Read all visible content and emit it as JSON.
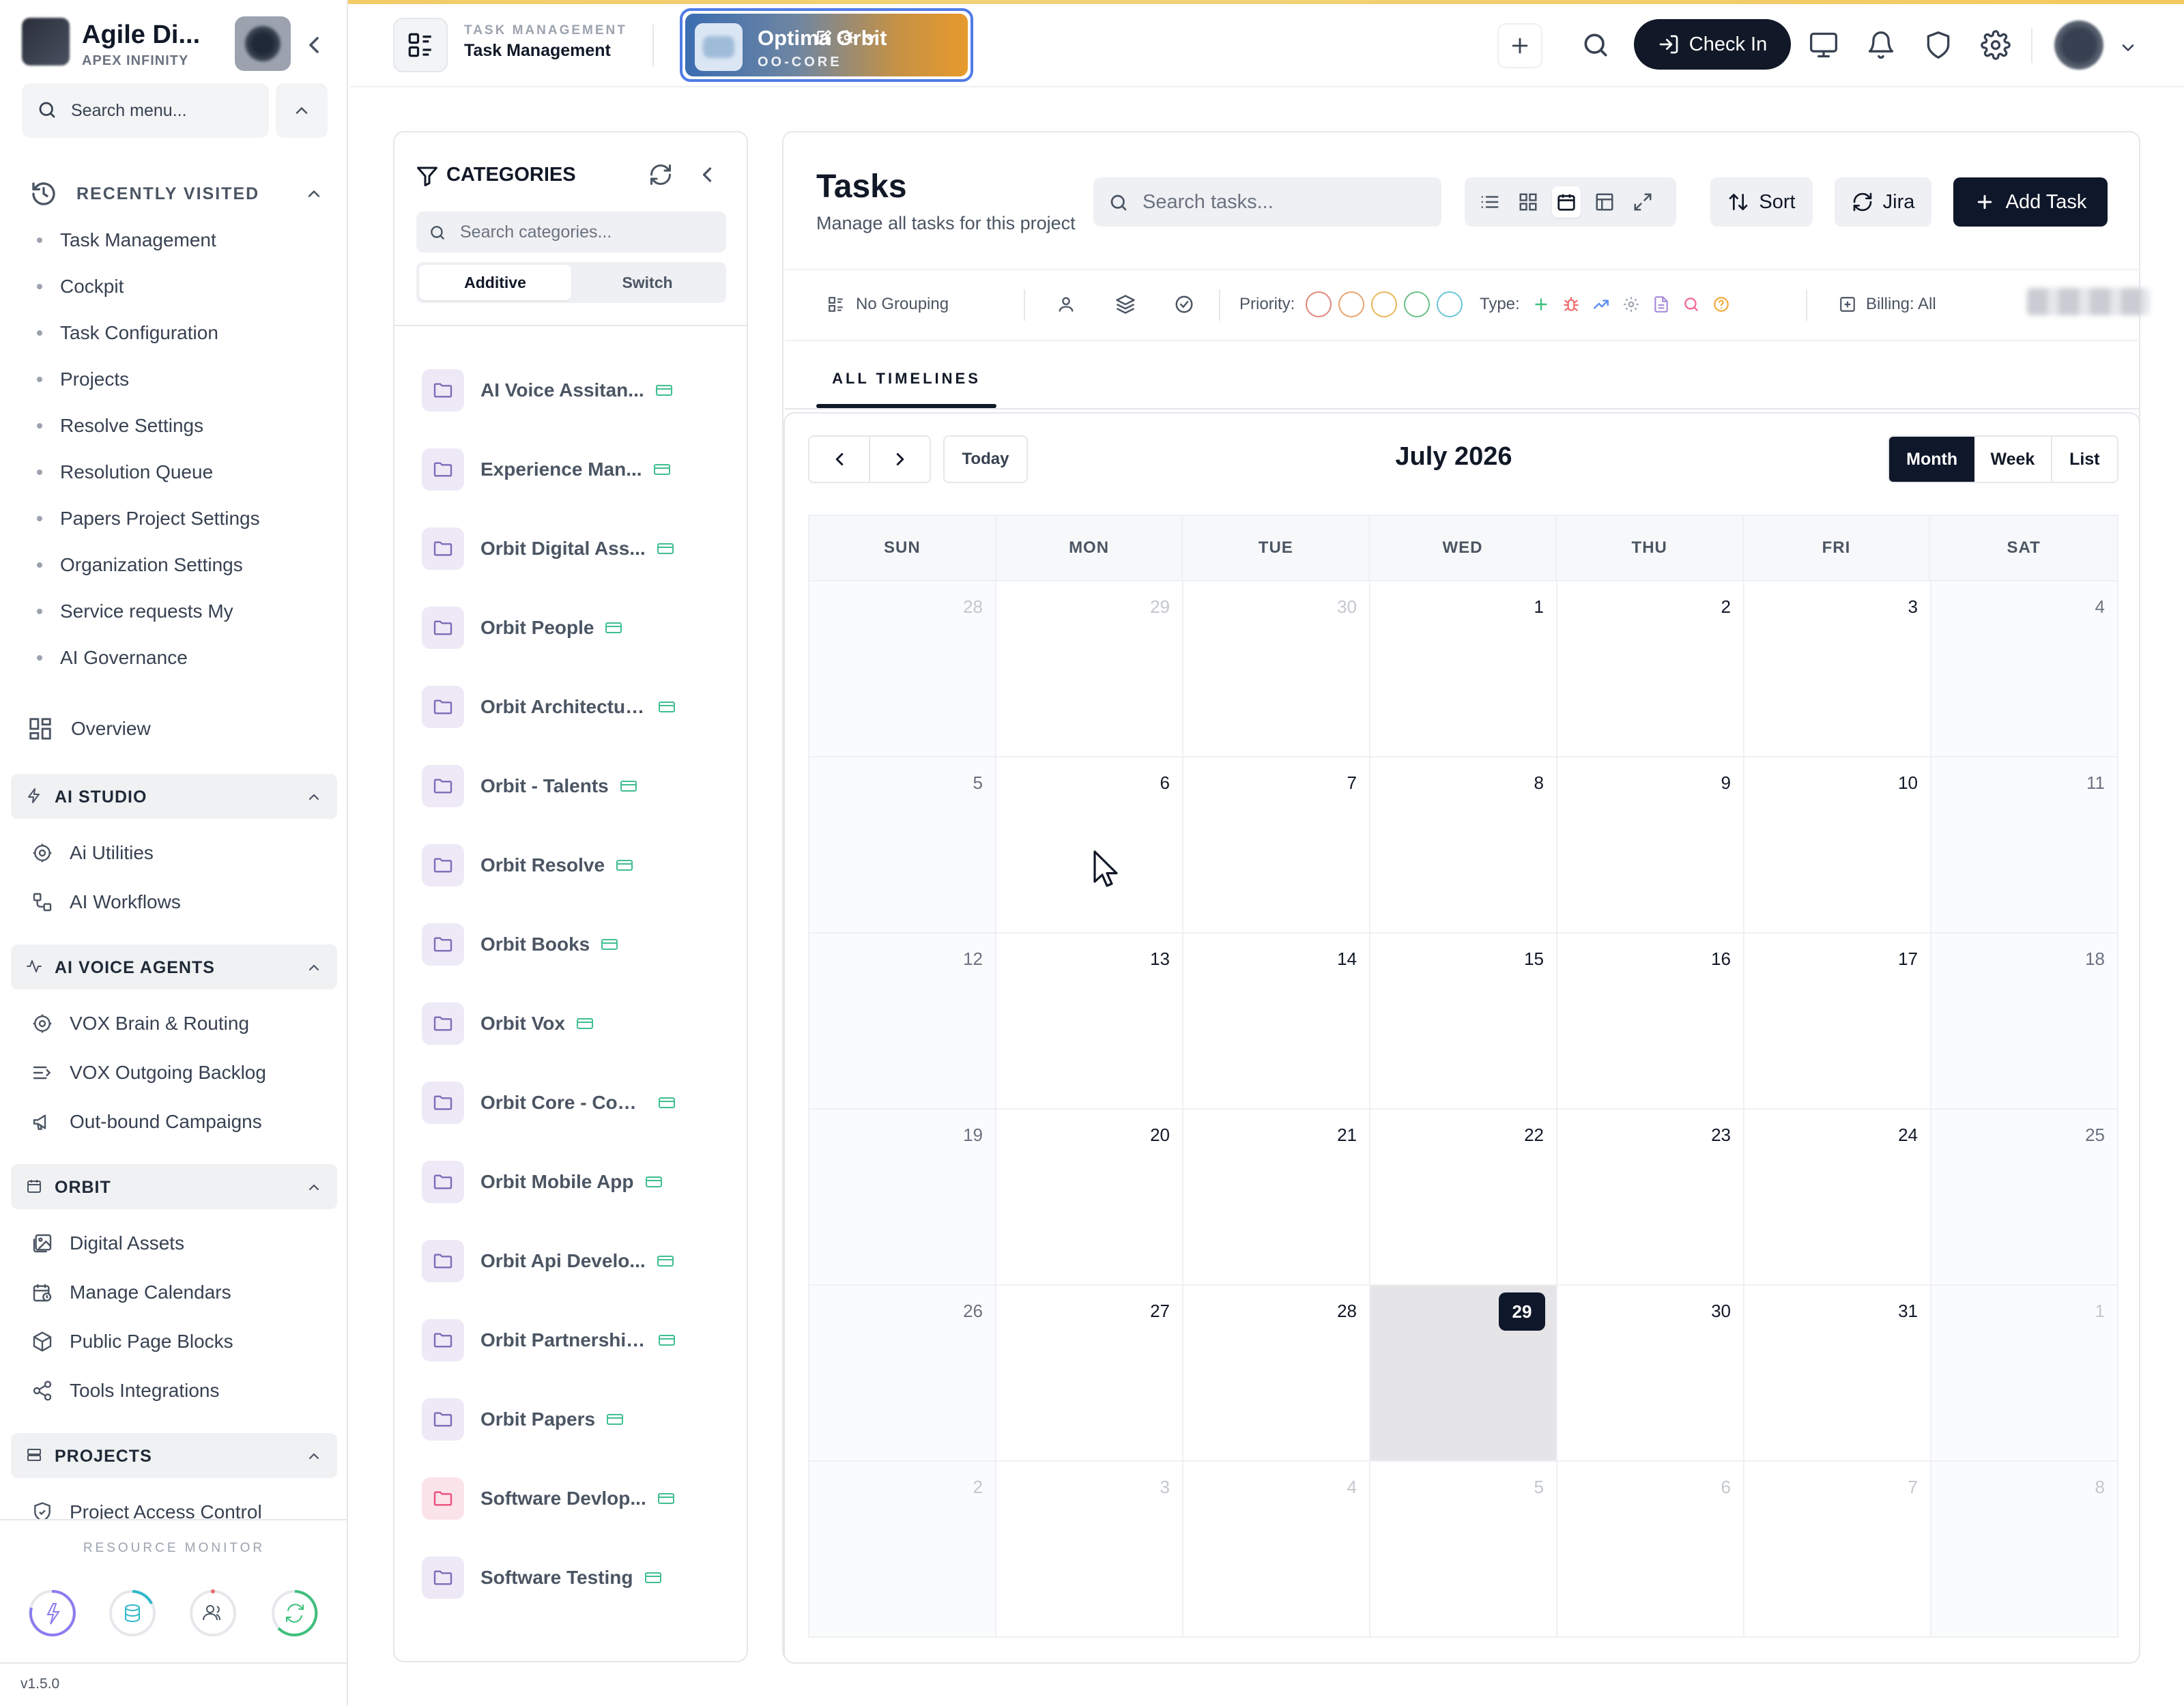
{
  "sidebar": {
    "brand": {
      "name": "Agile Di...",
      "sub": "APEX INFINITY"
    },
    "search_placeholder": "Search menu...",
    "recently_visited": {
      "title": "RECENTLY VISITED",
      "items": [
        {
          "label": "Task Management"
        },
        {
          "label": "Cockpit"
        },
        {
          "label": "Task Configuration"
        },
        {
          "label": "Projects"
        },
        {
          "label": "Resolve Settings"
        },
        {
          "label": "Resolution Queue"
        },
        {
          "label": "Papers Project Settings"
        },
        {
          "label": "Organization Settings"
        },
        {
          "label": "Service requests My"
        },
        {
          "label": "AI Governance"
        }
      ]
    },
    "overview_label": "Overview",
    "sections": [
      {
        "title": "AI STUDIO",
        "items": [
          {
            "label": "Ai Utilities",
            "icon": "gear-icon"
          },
          {
            "label": "AI Workflows",
            "icon": "workflow-icon"
          }
        ]
      },
      {
        "title": "AI VOICE AGENTS",
        "items": [
          {
            "label": "VOX Brain & Routing",
            "icon": "gear-icon"
          },
          {
            "label": "VOX Outgoing Backlog",
            "icon": "list-arrow-icon"
          },
          {
            "label": "Out-bound Campaigns",
            "icon": "megaphone-icon"
          }
        ]
      },
      {
        "title": "ORBIT",
        "items": [
          {
            "label": "Digital Assets",
            "icon": "image-icon"
          },
          {
            "label": "Manage Calendars",
            "icon": "calendar-clock-icon"
          },
          {
            "label": "Public Page Blocks",
            "icon": "box-icon"
          },
          {
            "label": "Tools Integrations",
            "icon": "share-icon"
          }
        ]
      },
      {
        "title": "PROJECTS",
        "items": [
          {
            "label": "Project Access Control",
            "icon": "shield-check-icon"
          }
        ]
      }
    ],
    "resource_monitor": {
      "title": "RESOURCE MONITOR"
    },
    "version": "v1.5.0"
  },
  "topbar": {
    "module_sub": "TASK MANAGEMENT",
    "module_title": "Task Management",
    "project": {
      "name": "Optima Orbit",
      "code": "OO-CORE"
    },
    "checkin_label": "Check In"
  },
  "categories": {
    "title": "CATEGORIES",
    "search_placeholder": "Search categories...",
    "mode_additive": "Additive",
    "mode_switch": "Switch",
    "items": [
      {
        "label": "AI Voice Assitan...",
        "color": "purple"
      },
      {
        "label": "Experience Man...",
        "color": "purple"
      },
      {
        "label": "Orbit Digital Ass...",
        "color": "purple"
      },
      {
        "label": "Orbit People",
        "color": "purple"
      },
      {
        "label": "Orbit Architectur...",
        "color": "purple"
      },
      {
        "label": "Orbit - Talents",
        "color": "purple"
      },
      {
        "label": "Orbit Resolve",
        "color": "purple"
      },
      {
        "label": "Orbit Books",
        "color": "purple"
      },
      {
        "label": "Orbit Vox",
        "color": "purple"
      },
      {
        "label": "Orbit Core - Com...",
        "color": "purple"
      },
      {
        "label": "Orbit Mobile App",
        "color": "purple"
      },
      {
        "label": "Orbit Api Develo...",
        "color": "purple"
      },
      {
        "label": "Orbit Partnerships",
        "color": "purple"
      },
      {
        "label": "Orbit Papers",
        "color": "purple"
      },
      {
        "label": "Software Devlop...",
        "color": "pink"
      },
      {
        "label": "Software Testing",
        "color": "purple"
      }
    ]
  },
  "tasks": {
    "title": "Tasks",
    "subtitle": "Manage all tasks for this project",
    "search_placeholder": "Search tasks...",
    "sort_label": "Sort",
    "jira_label": "Jira",
    "add_label": "Add Task",
    "filters": {
      "grouping": "No Grouping",
      "priority_label": "Priority:",
      "priority_colors": [
        "#e0867a",
        "#e8a470",
        "#e8b65a",
        "#6cc08a",
        "#6cc6d6"
      ],
      "type_label": "Type:",
      "billing": "Billing: All"
    },
    "timeline_tab": "ALL TIMELINES"
  },
  "calendar": {
    "title": "July 2026",
    "today_label": "Today",
    "views": {
      "month": "Month",
      "week": "Week",
      "list": "List"
    },
    "active_view": "Month",
    "weekdays": [
      "SUN",
      "MON",
      "TUE",
      "WED",
      "THU",
      "FRI",
      "SAT"
    ],
    "today": 29,
    "days": [
      {
        "n": "28",
        "out": true
      },
      {
        "n": "29",
        "out": true
      },
      {
        "n": "30",
        "out": true
      },
      {
        "n": "1"
      },
      {
        "n": "2"
      },
      {
        "n": "3"
      },
      {
        "n": "4"
      },
      {
        "n": "5"
      },
      {
        "n": "6"
      },
      {
        "n": "7"
      },
      {
        "n": "8"
      },
      {
        "n": "9"
      },
      {
        "n": "10"
      },
      {
        "n": "11"
      },
      {
        "n": "12"
      },
      {
        "n": "13"
      },
      {
        "n": "14"
      },
      {
        "n": "15"
      },
      {
        "n": "16"
      },
      {
        "n": "17"
      },
      {
        "n": "18"
      },
      {
        "n": "19"
      },
      {
        "n": "20"
      },
      {
        "n": "21"
      },
      {
        "n": "22"
      },
      {
        "n": "23"
      },
      {
        "n": "24"
      },
      {
        "n": "25"
      },
      {
        "n": "26"
      },
      {
        "n": "27"
      },
      {
        "n": "28"
      },
      {
        "n": "29",
        "today": true
      },
      {
        "n": "30"
      },
      {
        "n": "31"
      },
      {
        "n": "1",
        "out": true
      },
      {
        "n": "2",
        "out": true
      },
      {
        "n": "3",
        "out": true
      },
      {
        "n": "4",
        "out": true
      },
      {
        "n": "5",
        "out": true
      },
      {
        "n": "6",
        "out": true
      },
      {
        "n": "7",
        "out": true
      },
      {
        "n": "8",
        "out": true
      }
    ]
  }
}
